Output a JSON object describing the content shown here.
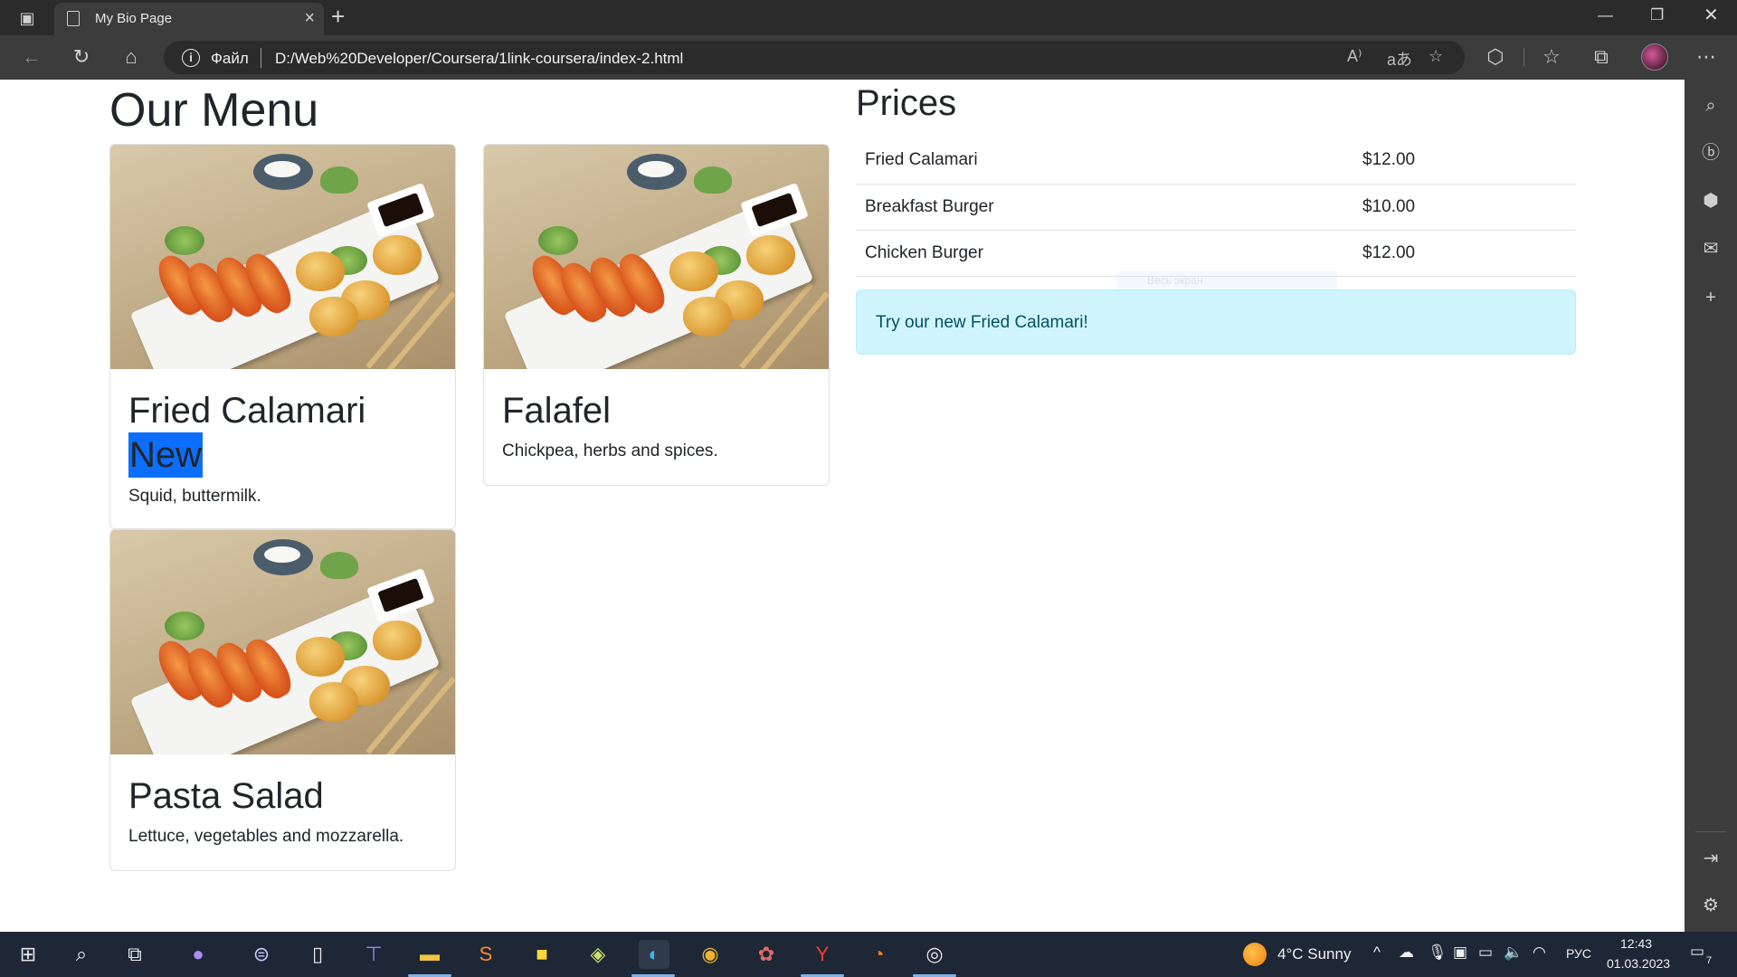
{
  "browser": {
    "tab_title": "My Bio Page",
    "address_label": "Файл",
    "address_url": "D:/Web%20Developer/Coursera/1link-coursera/index-2.html"
  },
  "page": {
    "menu_heading": "Our Menu",
    "prices_heading": "Prices",
    "cards": [
      {
        "title": "Fried Calamari",
        "badge": "New",
        "text": "Squid, buttermilk."
      },
      {
        "title": "Falafel",
        "text": "Chickpea, herbs and spices."
      },
      {
        "title": "Pasta Salad",
        "text": "Lettuce, vegetables and mozzarella."
      }
    ],
    "prices": [
      {
        "name": "Fried Calamari",
        "price": "$12.00"
      },
      {
        "name": "Breakfast Burger",
        "price": "$10.00"
      },
      {
        "name": "Chicken Burger",
        "price": "$12.00"
      }
    ],
    "alert": "Try our new Fried Calamari!",
    "overlay_hint": "Весь экран"
  },
  "taskbar": {
    "weather": "4°C  Sunny",
    "language": "РУС",
    "time": "12:43",
    "date": "01.03.2023",
    "notification_count": "7"
  },
  "colors": {
    "badge": "#0d6efd",
    "alert_bg": "#cff4fc",
    "alert_text": "#055160",
    "chrome_dark": "#2b2b2b",
    "taskbar": "#1d2736"
  }
}
